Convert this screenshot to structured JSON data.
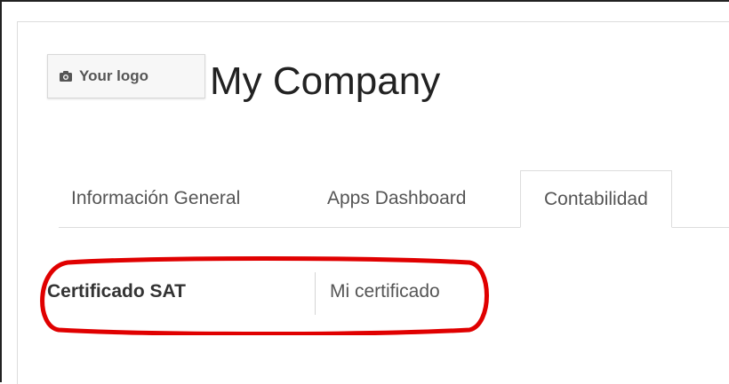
{
  "logo": {
    "placeholder_label": "Your logo",
    "icon": "camera-icon"
  },
  "company": {
    "name": "My Company"
  },
  "tabs": [
    {
      "label": "Información General",
      "active": false
    },
    {
      "label": "Apps Dashboard",
      "active": false
    },
    {
      "label": "Contabilidad",
      "active": true
    }
  ],
  "fields": {
    "sat_certificate": {
      "label": "Certificado SAT",
      "value": "Mi certificado"
    }
  },
  "colors": {
    "highlight": "#e00000",
    "text_dark": "#222222",
    "text_muted": "#555555",
    "border": "#dddddd"
  }
}
